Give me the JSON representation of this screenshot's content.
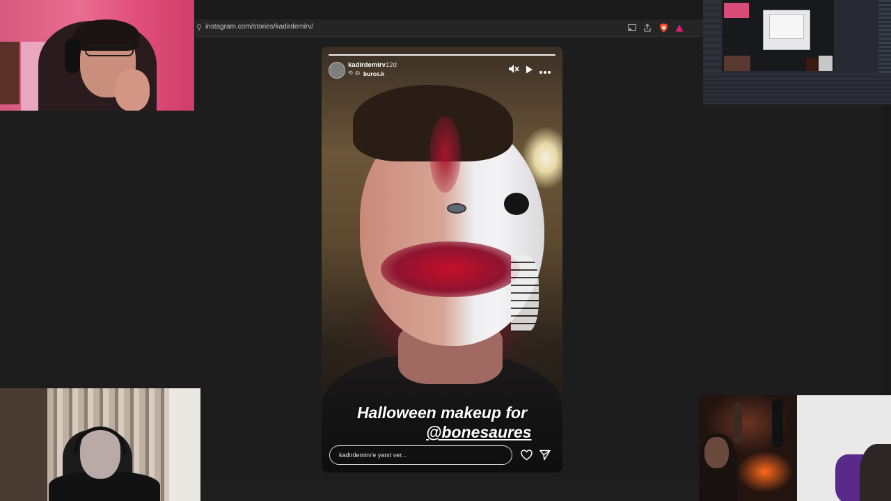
{
  "browser": {
    "url": "instagram.com/stories/kadirdemirv/"
  },
  "story": {
    "username": "kadirdemirv",
    "time_ago": "12d",
    "audio_user": "burce.k",
    "caption_line1": "Halloween makeup for",
    "caption_mention": "@bonesaures",
    "reply_placeholder": "kadirdemirv'e yanıt ver...",
    "progress": 1.0
  },
  "icons": {
    "mute": "speaker-muted-icon",
    "play": "play-icon",
    "more": "more-options-icon",
    "heart": "heart-icon",
    "send": "send-icon"
  },
  "colors": {
    "background": "#1d1d1d",
    "story_text": "#ffffff",
    "brave_lion": "#fb542b",
    "rewards": "#e01e68"
  }
}
